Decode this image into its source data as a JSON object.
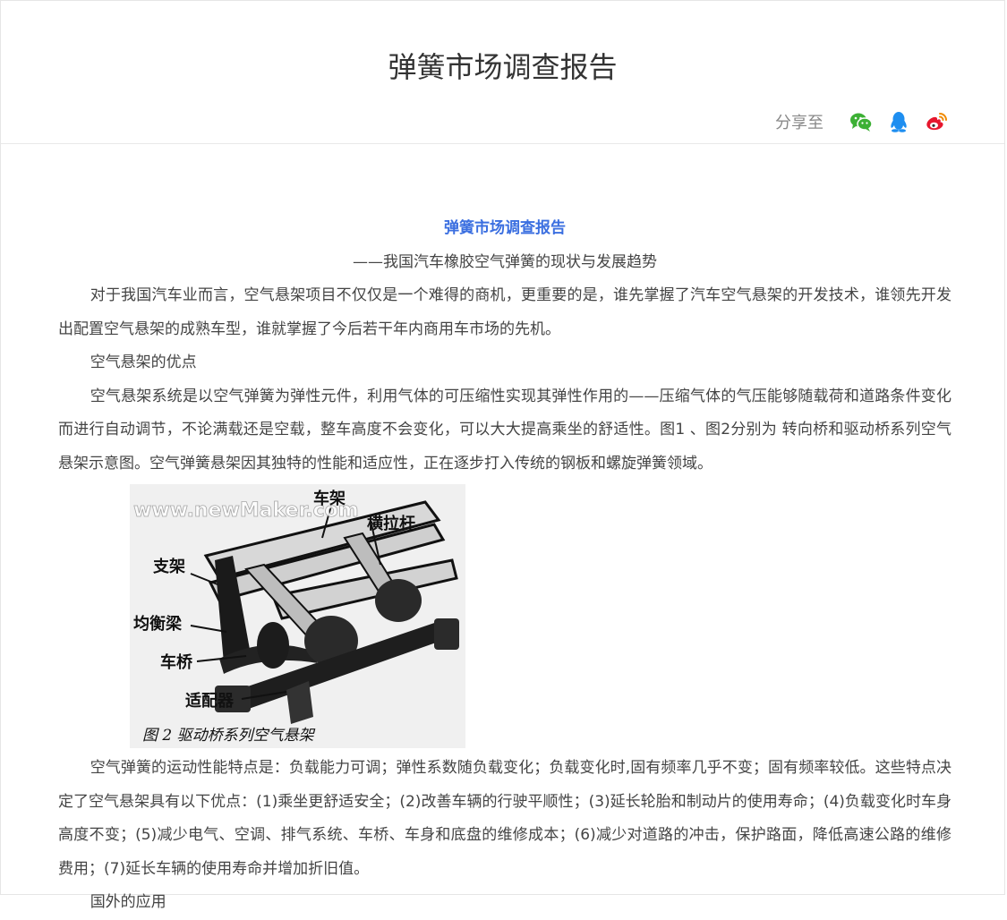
{
  "header": {
    "title": "弹簧市场调查报告",
    "share_label": "分享至",
    "share_icons": [
      "wechat-icon",
      "qq-icon",
      "weibo-icon"
    ]
  },
  "article": {
    "title": "弹簧市场调查报告",
    "subtitle": "——我国汽车橡胶空气弹簧的现状与发展趋势",
    "p1": "对于我国汽车业而言，空气悬架项目不仅仅是一个难得的商机，更重要的是，谁先掌握了汽车空气悬架的开发技术，谁领先开发出配置空气悬架的成熟车型，谁就掌握了今后若干年内商用车市场的先机。",
    "p2": "空气悬架的优点",
    "p3": "空气悬架系统是以空气弹簧为弹性元件，利用气体的可压缩性实现其弹性作用的——压缩气体的气压能够随载荷和道路条件变化而进行自动调节，不论满载还是空载，整车高度不会变化，可以大大提高乘坐的舒适性。图1 、图2分别为 转向桥和驱动桥系列空气悬架示意图。空气弹簧悬架因其独特的性能和适应性，正在逐步打入传统的钢板和螺旋弹簧领域。",
    "p4": "空气弹簧的运动性能特点是：负载能力可调；弹性系数随负载变化；负载变化时,固有频率几乎不变；固有频率较低。这些特点决定了空气悬架具有以下优点：(1)乘坐更舒适安全；(2)改善车辆的行驶平顺性；(3)延长轮胎和制动片的使用寿命；(4)负载变化时车身高度不变；(5)减少电气、空调、排气系统、车桥、车身和底盘的维修成本；(6)减少对道路的冲击，保护路面，降低高速公路的维修费用；(7)延长车辆的使用寿命并增加折旧值。",
    "p5": "国外的应用"
  },
  "figure": {
    "watermark": "www.newMaker.com",
    "labels": {
      "frame": "车架",
      "tie_rod": "横拉杆",
      "bracket": "支架",
      "equalizer": "均衡梁",
      "axle": "车桥",
      "adapter": "适配器"
    },
    "caption": "图 2  驱动桥系列空气悬架"
  },
  "colors": {
    "article_title": "#3b6fe0",
    "wechat": "#3cb034",
    "qq": "#1e8ef0",
    "weibo": "#e6162d"
  }
}
